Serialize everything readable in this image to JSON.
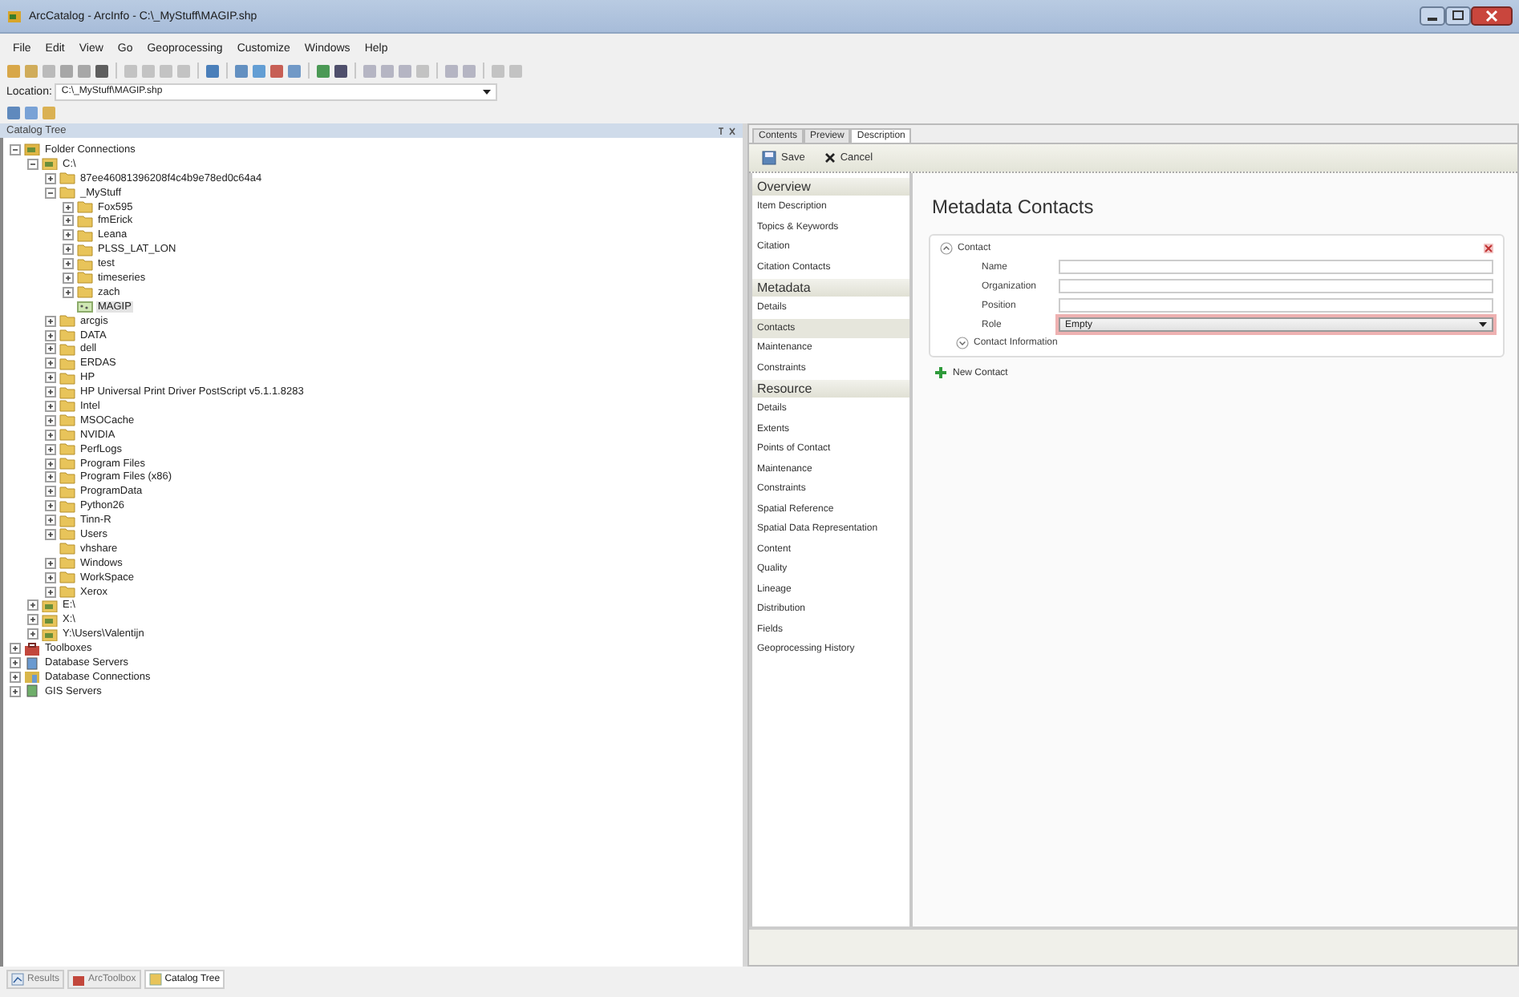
{
  "window": {
    "title": "ArcCatalog - ArcInfo - C:\\_MyStuff\\MAGIP.shp"
  },
  "menu": [
    "File",
    "Edit",
    "View",
    "Go",
    "Geoprocessing",
    "Customize",
    "Windows",
    "Help"
  ],
  "location": {
    "label": "Location:",
    "value": "C:\\_MyStuff\\MAGIP.shp"
  },
  "catalog_tree": {
    "title": "Catalog Tree",
    "items": [
      {
        "label": "Folder Connections",
        "kind": "folder-connections",
        "expanded": true,
        "selected": false,
        "children": [
          {
            "label": "C:\\",
            "kind": "drive",
            "expanded": true,
            "selected": false,
            "children": [
              {
                "label": "87ee46081396208f4c4b9e78ed0c64a4",
                "kind": "folder",
                "expanded": false,
                "selected": false
              },
              {
                "label": "_MyStuff",
                "kind": "folder",
                "expanded": true,
                "selected": false,
                "children": [
                  {
                    "label": "Fox595",
                    "kind": "folder",
                    "expanded": false,
                    "selected": false
                  },
                  {
                    "label": "fmErick",
                    "kind": "folder",
                    "expanded": false,
                    "selected": false
                  },
                  {
                    "label": "Leana",
                    "kind": "folder",
                    "expanded": false,
                    "selected": false
                  },
                  {
                    "label": "PLSS_LAT_LON",
                    "kind": "folder",
                    "expanded": false,
                    "selected": false
                  },
                  {
                    "label": "test",
                    "kind": "folder",
                    "expanded": false,
                    "selected": false
                  },
                  {
                    "label": "timeseries",
                    "kind": "folder",
                    "expanded": false,
                    "selected": false
                  },
                  {
                    "label": "zach",
                    "kind": "folder",
                    "expanded": false,
                    "selected": false
                  },
                  {
                    "label": "MAGIP",
                    "kind": "shapefile",
                    "selected": true
                  }
                ]
              },
              {
                "label": "arcgis",
                "kind": "folder",
                "expanded": false,
                "selected": false
              },
              {
                "label": "DATA",
                "kind": "folder",
                "expanded": false,
                "selected": false
              },
              {
                "label": "dell",
                "kind": "folder",
                "expanded": false,
                "selected": false
              },
              {
                "label": "ERDAS",
                "kind": "folder",
                "expanded": false,
                "selected": false
              },
              {
                "label": "HP",
                "kind": "folder",
                "expanded": false,
                "selected": false
              },
              {
                "label": "HP Universal Print Driver PostScript v5.1.1.8283",
                "kind": "folder",
                "expanded": false,
                "selected": false
              },
              {
                "label": "Intel",
                "kind": "folder",
                "expanded": false,
                "selected": false
              },
              {
                "label": "MSOCache",
                "kind": "folder",
                "expanded": false,
                "selected": false
              },
              {
                "label": "NVIDIA",
                "kind": "folder",
                "expanded": false,
                "selected": false
              },
              {
                "label": "PerfLogs",
                "kind": "folder",
                "expanded": false,
                "selected": false
              },
              {
                "label": "Program Files",
                "kind": "folder",
                "expanded": false,
                "selected": false
              },
              {
                "label": "Program Files (x86)",
                "kind": "folder",
                "expanded": false,
                "selected": false
              },
              {
                "label": "ProgramData",
                "kind": "folder",
                "expanded": false,
                "selected": false
              },
              {
                "label": "Python26",
                "kind": "folder",
                "expanded": false,
                "selected": false
              },
              {
                "label": "Tinn-R",
                "kind": "folder",
                "expanded": false,
                "selected": false
              },
              {
                "label": "Users",
                "kind": "folder",
                "expanded": false,
                "selected": false
              },
              {
                "label": "vhshare",
                "kind": "folder",
                "selected": false
              },
              {
                "label": "Windows",
                "kind": "folder",
                "expanded": false,
                "selected": false
              },
              {
                "label": "WorkSpace",
                "kind": "folder",
                "expanded": false,
                "selected": false
              },
              {
                "label": "Xerox",
                "kind": "folder",
                "expanded": false,
                "selected": false
              }
            ]
          },
          {
            "label": "E:\\",
            "kind": "drive",
            "expanded": false,
            "selected": false
          },
          {
            "label": "X:\\",
            "kind": "drive",
            "expanded": false,
            "selected": false
          },
          {
            "label": "Y:\\Users\\Valentijn",
            "kind": "drive",
            "expanded": false,
            "selected": false
          }
        ]
      },
      {
        "label": "Toolboxes",
        "kind": "toolboxes",
        "expanded": false,
        "selected": false
      },
      {
        "label": "Database Servers",
        "kind": "database-servers",
        "expanded": false,
        "selected": false
      },
      {
        "label": "Database Connections",
        "kind": "database-connections",
        "expanded": false,
        "selected": false
      },
      {
        "label": "GIS Servers",
        "kind": "gis-servers",
        "expanded": false,
        "selected": false
      }
    ]
  },
  "bottom_tabs": [
    {
      "label": "Results",
      "kind": "results",
      "selected": false
    },
    {
      "label": "ArcToolbox",
      "kind": "toolbox",
      "selected": false
    },
    {
      "label": "Catalog Tree",
      "kind": "catalog",
      "selected": true
    }
  ],
  "view_tabs": [
    {
      "label": "Contents",
      "selected": false
    },
    {
      "label": "Preview",
      "selected": false
    },
    {
      "label": "Description",
      "selected": true
    }
  ],
  "description_toolbar": [
    {
      "label": "Save",
      "kind": "save"
    },
    {
      "label": "Cancel",
      "kind": "cancel"
    }
  ],
  "description_nav": [
    {
      "label": "Overview",
      "kind": "header",
      "selected": false
    },
    {
      "label": "Item Description",
      "kind": "item",
      "selected": false
    },
    {
      "label": "Topics & Keywords",
      "kind": "item",
      "selected": false
    },
    {
      "label": "Citation",
      "kind": "item",
      "selected": false
    },
    {
      "label": "Citation Contacts",
      "kind": "item",
      "selected": false
    },
    {
      "label": "Metadata",
      "kind": "header",
      "selected": false
    },
    {
      "label": "Details",
      "kind": "item",
      "selected": false
    },
    {
      "label": "Contacts",
      "kind": "item",
      "selected": true
    },
    {
      "label": "Maintenance",
      "kind": "item",
      "selected": false
    },
    {
      "label": "Constraints",
      "kind": "item",
      "selected": false
    },
    {
      "label": "Resource",
      "kind": "header",
      "selected": false
    },
    {
      "label": "Details",
      "kind": "item",
      "selected": false
    },
    {
      "label": "Extents",
      "kind": "item",
      "selected": false
    },
    {
      "label": "Points of Contact",
      "kind": "item",
      "selected": false
    },
    {
      "label": "Maintenance",
      "kind": "item",
      "selected": false
    },
    {
      "label": "Constraints",
      "kind": "item",
      "selected": false
    },
    {
      "label": "Spatial Reference",
      "kind": "item",
      "selected": false
    },
    {
      "label": "Spatial Data Representation",
      "kind": "item",
      "selected": false
    },
    {
      "label": "Content",
      "kind": "item",
      "selected": false
    },
    {
      "label": "Quality",
      "kind": "item",
      "selected": false
    },
    {
      "label": "Lineage",
      "kind": "item",
      "selected": false
    },
    {
      "label": "Distribution",
      "kind": "item",
      "selected": false
    },
    {
      "label": "Fields",
      "kind": "item",
      "selected": false
    },
    {
      "label": "Geoprocessing History",
      "kind": "item",
      "selected": false
    }
  ],
  "metadata_contacts": {
    "heading": "Metadata Contacts",
    "contact": {
      "title": "Contact",
      "expanded": true,
      "fields": [
        {
          "label": "Name",
          "kind": "text"
        },
        {
          "label": "Organization",
          "kind": "text"
        },
        {
          "label": "Position",
          "kind": "text"
        },
        {
          "label": "Role",
          "kind": "dropdown",
          "value": "Empty",
          "invalid": true
        }
      ],
      "contact_information": {
        "title": "Contact Information",
        "expanded": false
      }
    },
    "new_contact": "New Contact"
  }
}
